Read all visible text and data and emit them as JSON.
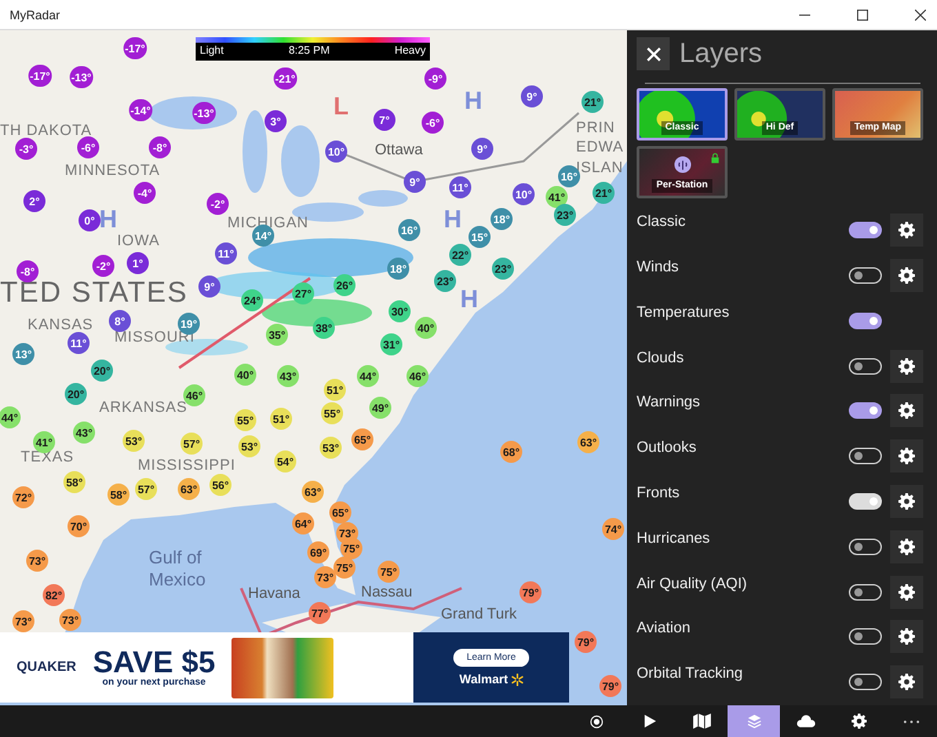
{
  "window": {
    "title": "MyRadar"
  },
  "map": {
    "legend": {
      "low": "Light",
      "time": "8:25 PM",
      "high": "Heavy"
    },
    "labels": [
      {
        "text": "L",
        "kind": "low"
      },
      {
        "text": "H",
        "kind": "high"
      },
      {
        "text": "TH DAKOTA",
        "kind": "state"
      },
      {
        "text": "PRIN",
        "kind": "state"
      },
      {
        "text": "Ottawa",
        "kind": "city"
      },
      {
        "text": "EDWA",
        "kind": "state"
      },
      {
        "text": "MINNESOTA",
        "kind": "state"
      },
      {
        "text": "ISLAN",
        "kind": "state"
      },
      {
        "text": "H",
        "kind": "high"
      },
      {
        "text": "MICHIGAN",
        "kind": "state"
      },
      {
        "text": "H",
        "kind": "high"
      },
      {
        "text": "IOWA",
        "kind": "state"
      },
      {
        "text": "TED STATES",
        "kind": "country"
      },
      {
        "text": "H",
        "kind": "high"
      },
      {
        "text": "KANSAS",
        "kind": "state"
      },
      {
        "text": "MISSOURI",
        "kind": "state"
      },
      {
        "text": "ARKANSAS",
        "kind": "state"
      },
      {
        "text": "TEXAS",
        "kind": "state"
      },
      {
        "text": "MISSISSIPPI",
        "kind": "state"
      },
      {
        "text": "Gulf of Mexico",
        "kind": "water"
      },
      {
        "text": "Havana",
        "kind": "city"
      },
      {
        "text": "Nassau",
        "kind": "city"
      },
      {
        "text": "Grand Turk",
        "kind": "city"
      }
    ],
    "markers": [
      {
        "text": "-17°",
        "color": "#a21fd4"
      },
      {
        "text": "-17°",
        "color": "#a21fd4"
      },
      {
        "text": "-13°",
        "color": "#a21fd4"
      },
      {
        "text": "-21°",
        "color": "#a21fd4"
      },
      {
        "text": "-9°",
        "color": "#a21fd4"
      },
      {
        "text": "9°",
        "color": "#6a4fd6"
      },
      {
        "text": "21°",
        "color": "#35b5a0"
      },
      {
        "text": "-14°",
        "color": "#a21fd4"
      },
      {
        "text": "-13°",
        "color": "#a21fd4"
      },
      {
        "text": "3°",
        "color": "#7a2bd8"
      },
      {
        "text": "7°",
        "color": "#7a2bd8"
      },
      {
        "text": "-6°",
        "color": "#a21fd4"
      },
      {
        "text": "-3°",
        "color": "#a21fd4"
      },
      {
        "text": "-6°",
        "color": "#a21fd4"
      },
      {
        "text": "-8°",
        "color": "#a21fd4"
      },
      {
        "text": "10°",
        "color": "#6a4fd6"
      },
      {
        "text": "9°",
        "color": "#6a4fd6"
      },
      {
        "text": "2°",
        "color": "#7a2bd8"
      },
      {
        "text": "-4°",
        "color": "#a21fd4"
      },
      {
        "text": "-2°",
        "color": "#a21fd4"
      },
      {
        "text": "9°",
        "color": "#6a4fd6"
      },
      {
        "text": "11°",
        "color": "#6a4fd6"
      },
      {
        "text": "10°",
        "color": "#6a4fd6"
      },
      {
        "text": "41°",
        "color": "#86e06a"
      },
      {
        "text": "16°",
        "color": "#3f8fa8"
      },
      {
        "text": "21°",
        "color": "#35b5a0"
      },
      {
        "text": "0°",
        "color": "#7a2bd8"
      },
      {
        "text": "14°",
        "color": "#3f8fa8"
      },
      {
        "text": "16°",
        "color": "#3f8fa8"
      },
      {
        "text": "18°",
        "color": "#3f8fa8"
      },
      {
        "text": "15°",
        "color": "#3f8fa8"
      },
      {
        "text": "23°",
        "color": "#35b5a0"
      },
      {
        "text": "-8°",
        "color": "#a21fd4"
      },
      {
        "text": "-2°",
        "color": "#a21fd4"
      },
      {
        "text": "1°",
        "color": "#7a2bd8"
      },
      {
        "text": "11°",
        "color": "#6a4fd6"
      },
      {
        "text": "18°",
        "color": "#3f8fa8"
      },
      {
        "text": "22°",
        "color": "#35b5a0"
      },
      {
        "text": "23°",
        "color": "#35b5a0"
      },
      {
        "text": "8°",
        "color": "#6a4fd6"
      },
      {
        "text": "9°",
        "color": "#6a4fd6"
      },
      {
        "text": "24°",
        "color": "#3fd38a"
      },
      {
        "text": "27°",
        "color": "#3fd38a"
      },
      {
        "text": "26°",
        "color": "#3fd38a"
      },
      {
        "text": "23°",
        "color": "#35b5a0"
      },
      {
        "text": "30°",
        "color": "#3fd38a"
      },
      {
        "text": "19°",
        "color": "#3f8fa8"
      },
      {
        "text": "11°",
        "color": "#6a4fd6"
      },
      {
        "text": "13°",
        "color": "#3f8fa8"
      },
      {
        "text": "20°",
        "color": "#35b5a0"
      },
      {
        "text": "20°",
        "color": "#35b5a0"
      },
      {
        "text": "35°",
        "color": "#86e06a"
      },
      {
        "text": "38°",
        "color": "#3fd38a"
      },
      {
        "text": "31°",
        "color": "#3fd38a"
      },
      {
        "text": "40°",
        "color": "#86e06a"
      },
      {
        "text": "40°",
        "color": "#86e06a"
      },
      {
        "text": "43°",
        "color": "#86e06a"
      },
      {
        "text": "44°",
        "color": "#86e06a"
      },
      {
        "text": "46°",
        "color": "#86e06a"
      },
      {
        "text": "46°",
        "color": "#86e06a"
      },
      {
        "text": "51°",
        "color": "#e8df5a"
      },
      {
        "text": "44°",
        "color": "#86e06a"
      },
      {
        "text": "41°",
        "color": "#86e06a"
      },
      {
        "text": "43°",
        "color": "#86e06a"
      },
      {
        "text": "53°",
        "color": "#e8df5a"
      },
      {
        "text": "57°",
        "color": "#e8df5a"
      },
      {
        "text": "55°",
        "color": "#e8df5a"
      },
      {
        "text": "51°",
        "color": "#e8df5a"
      },
      {
        "text": "55°",
        "color": "#e8df5a"
      },
      {
        "text": "49°",
        "color": "#86e06a"
      },
      {
        "text": "53°",
        "color": "#e8df5a"
      },
      {
        "text": "54°",
        "color": "#e8df5a"
      },
      {
        "text": "53°",
        "color": "#e8df5a"
      },
      {
        "text": "65°",
        "color": "#f59a4a"
      },
      {
        "text": "68°",
        "color": "#f59a4a"
      },
      {
        "text": "63°",
        "color": "#f5b04a"
      },
      {
        "text": "72°",
        "color": "#f59a4a"
      },
      {
        "text": "58°",
        "color": "#e8df5a"
      },
      {
        "text": "58°",
        "color": "#f5b04a"
      },
      {
        "text": "57°",
        "color": "#e8df5a"
      },
      {
        "text": "63°",
        "color": "#f5b04a"
      },
      {
        "text": "56°",
        "color": "#e8df5a"
      },
      {
        "text": "63°",
        "color": "#f5b04a"
      },
      {
        "text": "70°",
        "color": "#f59a4a"
      },
      {
        "text": "64°",
        "color": "#f59a4a"
      },
      {
        "text": "65°",
        "color": "#f59a4a"
      },
      {
        "text": "73°",
        "color": "#f59a4a"
      },
      {
        "text": "74°",
        "color": "#f59a4a"
      },
      {
        "text": "73°",
        "color": "#f59a4a"
      },
      {
        "text": "69°",
        "color": "#f59a4a"
      },
      {
        "text": "75°",
        "color": "#f59a4a"
      },
      {
        "text": "75°",
        "color": "#f59a4a"
      },
      {
        "text": "75°",
        "color": "#f59a4a"
      },
      {
        "text": "82°",
        "color": "#f27858"
      },
      {
        "text": "73°",
        "color": "#f59a4a"
      },
      {
        "text": "77°",
        "color": "#f27858"
      },
      {
        "text": "79°",
        "color": "#f27858"
      },
      {
        "text": "73°",
        "color": "#f59a4a"
      },
      {
        "text": "73°",
        "color": "#f59a4a"
      },
      {
        "text": "79°",
        "color": "#f27858"
      },
      {
        "text": "79°",
        "color": "#f27858"
      }
    ]
  },
  "ad": {
    "brand": "QUAKER",
    "headline": "SAVE $5",
    "subline": "on your next purchase",
    "button": "Learn More",
    "retailer": "Walmart"
  },
  "panel": {
    "title": "Layers",
    "tiles": [
      {
        "label": "Classic",
        "kind": "radar",
        "selected": true,
        "locked": false
      },
      {
        "label": "Hi Def",
        "kind": "hidef",
        "selected": false,
        "locked": false
      },
      {
        "label": "Temp Map",
        "kind": "temp",
        "selected": false,
        "locked": false
      },
      {
        "label": "Per-Station",
        "kind": "station",
        "selected": false,
        "locked": true
      }
    ],
    "layers": [
      {
        "name": "Classic",
        "on": true,
        "settings": true
      },
      {
        "name": "Winds",
        "on": false,
        "settings": true
      },
      {
        "name": "Temperatures",
        "on": true,
        "settings": false
      },
      {
        "name": "Clouds",
        "on": false,
        "settings": true
      },
      {
        "name": "Warnings",
        "on": true,
        "settings": true
      },
      {
        "name": "Outlooks",
        "on": false,
        "settings": true
      },
      {
        "name": "Fronts",
        "on": true,
        "pressed": true,
        "settings": true
      },
      {
        "name": "Hurricanes",
        "on": false,
        "settings": true
      },
      {
        "name": "Air Quality (AQI)",
        "on": false,
        "settings": true
      },
      {
        "name": "Aviation",
        "on": false,
        "settings": true
      },
      {
        "name": "Orbital Tracking",
        "on": false,
        "settings": true
      }
    ]
  },
  "toolbar": {
    "items": [
      {
        "kind": "target",
        "selected": false
      },
      {
        "kind": "play",
        "selected": false
      },
      {
        "kind": "map",
        "selected": false
      },
      {
        "kind": "layers",
        "selected": true
      },
      {
        "kind": "weather",
        "selected": false
      },
      {
        "kind": "settings",
        "selected": false
      },
      {
        "kind": "more",
        "selected": false
      }
    ]
  }
}
